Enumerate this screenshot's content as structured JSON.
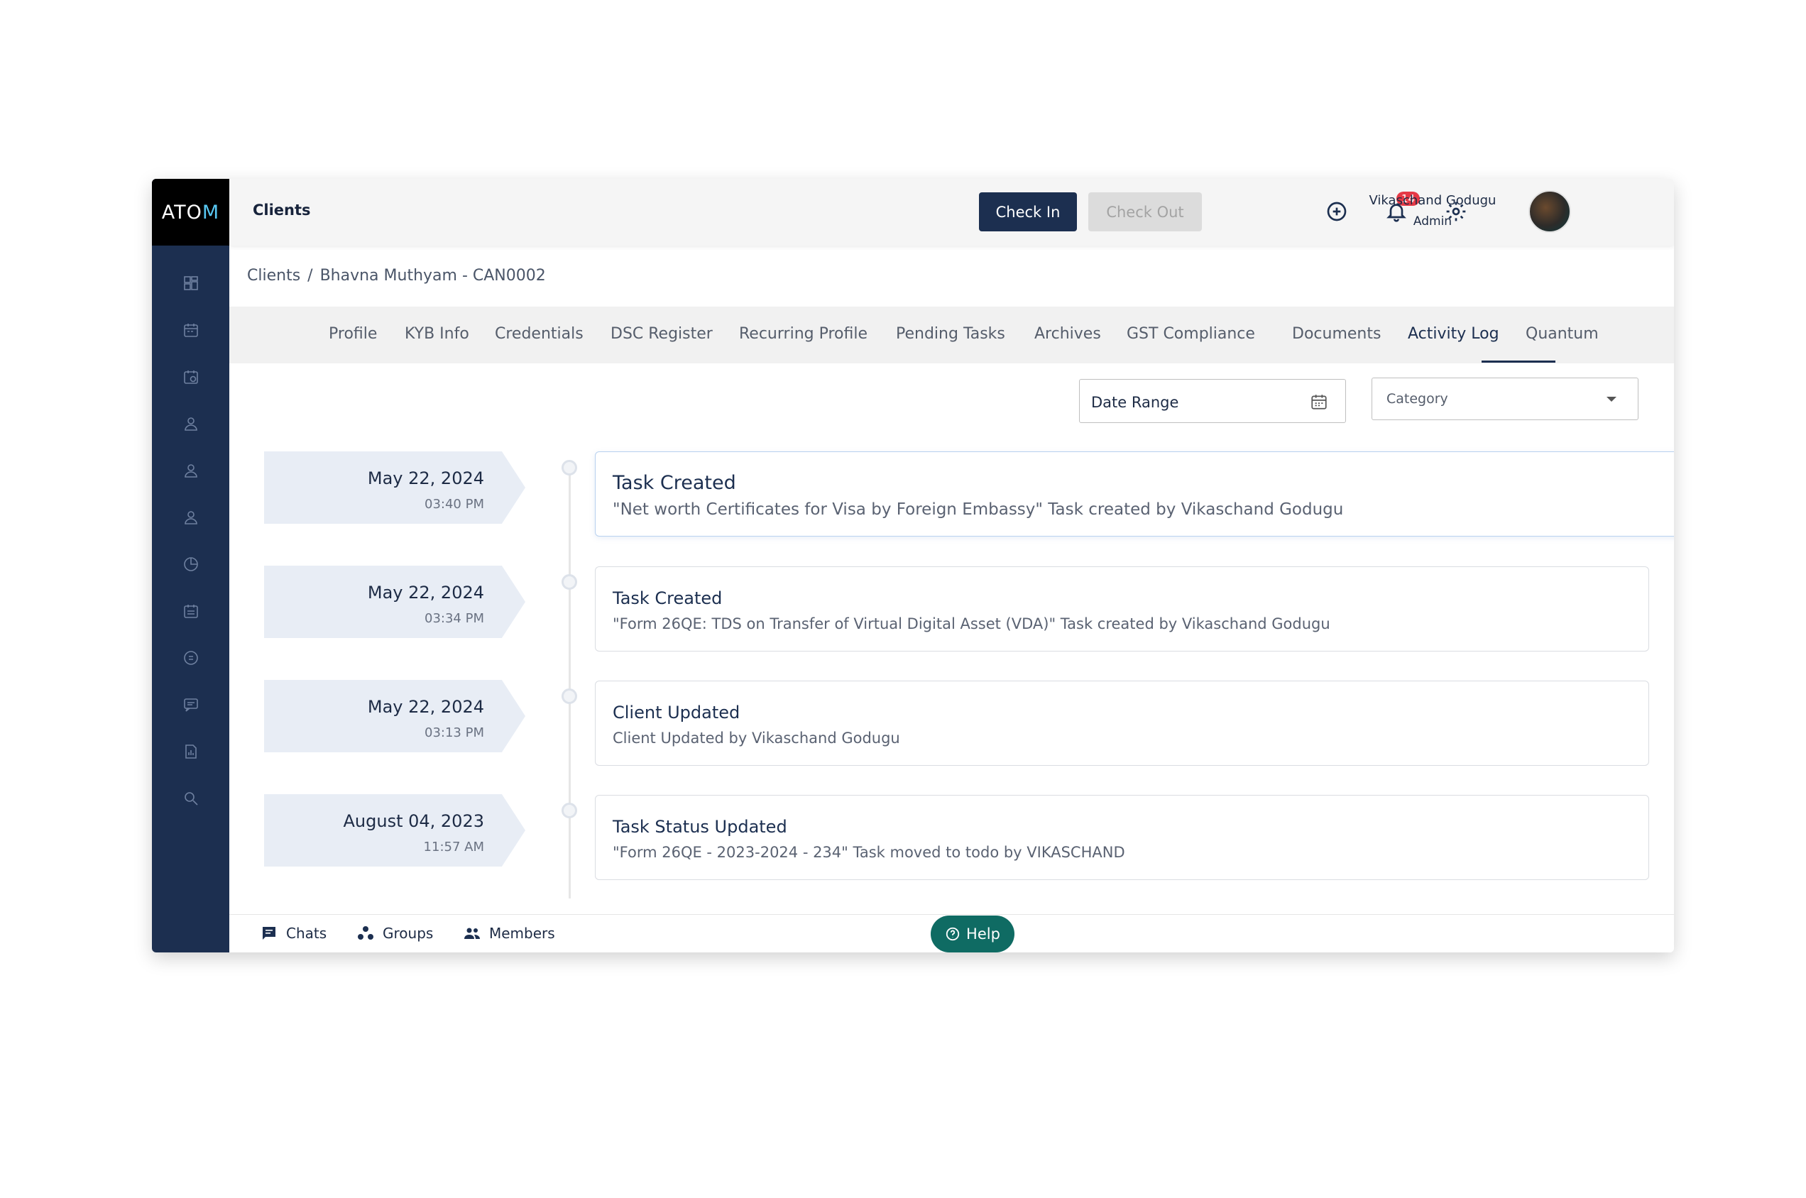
{
  "brand": {
    "logo": "ATOM"
  },
  "header": {
    "title": "Clients",
    "check_in": "Check In",
    "check_out": "Check Out",
    "notification_count": "14",
    "user_name": "Vikaschand Godugu",
    "user_role": "Admin"
  },
  "sidebar": {
    "icons": [
      "dashboard-icon",
      "calendar-icon",
      "calendar-clock-icon",
      "user-icon",
      "user-icon",
      "user-icon",
      "pie-chart-icon",
      "checklist-calendar-icon",
      "coin-icon",
      "chat-icon",
      "report-icon",
      "search-icon"
    ]
  },
  "breadcrumb": {
    "root": "Clients",
    "separator": "/",
    "current": "Bhavna Muthyam - CAN0002"
  },
  "tabs": [
    "Profile",
    "KYB Info",
    "Credentials",
    "DSC Register",
    "Recurring Profile",
    "Pending Tasks",
    "Archives",
    "GST Compliance",
    "Documents",
    "Activity Log",
    "Quantum"
  ],
  "active_tab": "Activity Log",
  "filters": {
    "date_range": "Date Range",
    "category": "Category"
  },
  "activities": [
    {
      "date": "May 22, 2024",
      "time": "03:40 PM",
      "title": "Task Created",
      "description": "\"Net worth Certificates for Visa by Foreign Embassy\" Task created by Vikaschand Godugu"
    },
    {
      "date": "May 22, 2024",
      "time": "03:34 PM",
      "title": "Task Created",
      "description": "\"Form 26QE: TDS on Transfer of Virtual Digital Asset (VDA)\" Task created by Vikaschand Godugu"
    },
    {
      "date": "May 22, 2024",
      "time": "03:13 PM",
      "title": "Client Updated",
      "description": "Client Updated by Vikaschand Godugu"
    },
    {
      "date": "August 04, 2023",
      "time": "11:57 AM",
      "title": "Task Status Updated",
      "description": "\"Form 26QE - 2023-2024 - 234\" Task moved to todo by VIKASCHAND"
    }
  ],
  "bottom": {
    "chats": "Chats",
    "groups": "Groups",
    "members": "Members",
    "help": "Help"
  }
}
